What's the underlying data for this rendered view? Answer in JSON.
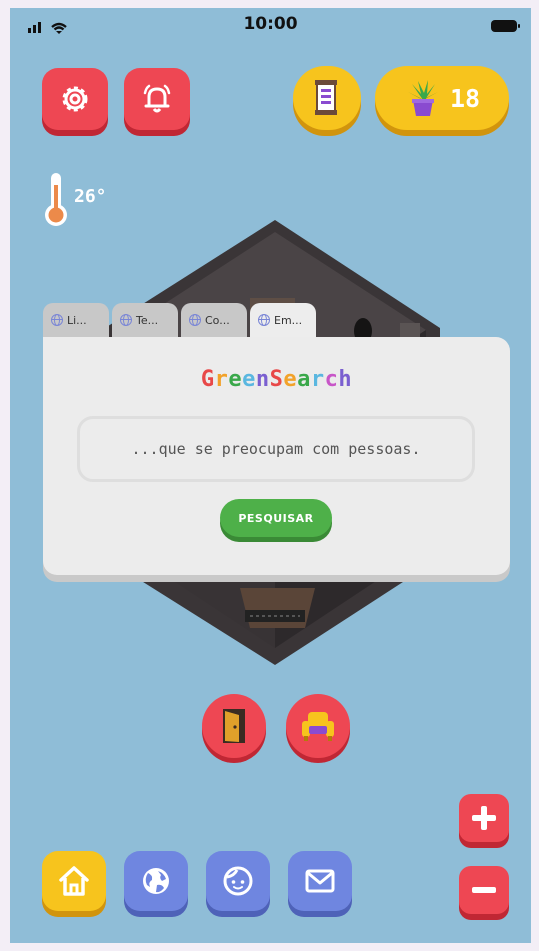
{
  "status_bar": {
    "time": "10:00"
  },
  "hud": {
    "plant_count": "18",
    "temperature": "26°"
  },
  "browser": {
    "tabs": [
      {
        "label": "Li..."
      },
      {
        "label": "Te..."
      },
      {
        "label": "Co..."
      },
      {
        "label": "Em..."
      }
    ],
    "logo_letters": [
      "G",
      "r",
      "e",
      "e",
      "n",
      "S",
      "e",
      "a",
      "r",
      "c",
      "h"
    ],
    "logo_colors": [
      "#e84848",
      "#f2a22a",
      "#3aa84a",
      "#5ab7e0",
      "#7a5fd0",
      "#e84848",
      "#f2a22a",
      "#3aa84a",
      "#5ab7e0",
      "#c856c8",
      "#7a5fd0"
    ],
    "search_value": "...que se preocupam com pessoas.",
    "search_button": "PESQUISAR"
  },
  "colors": {
    "background": "#8fbdd7",
    "red": "#ee4753",
    "yellow": "#f7c41d",
    "blue": "#6f86e0",
    "green": "#4eb049"
  },
  "icons": [
    "gear-icon",
    "bell-icon",
    "scroll-icon",
    "plant-icon",
    "thermometer-icon",
    "door-icon",
    "armchair-icon",
    "plus-icon",
    "minus-icon",
    "home-icon",
    "globe-icon",
    "face-icon",
    "mail-icon"
  ]
}
